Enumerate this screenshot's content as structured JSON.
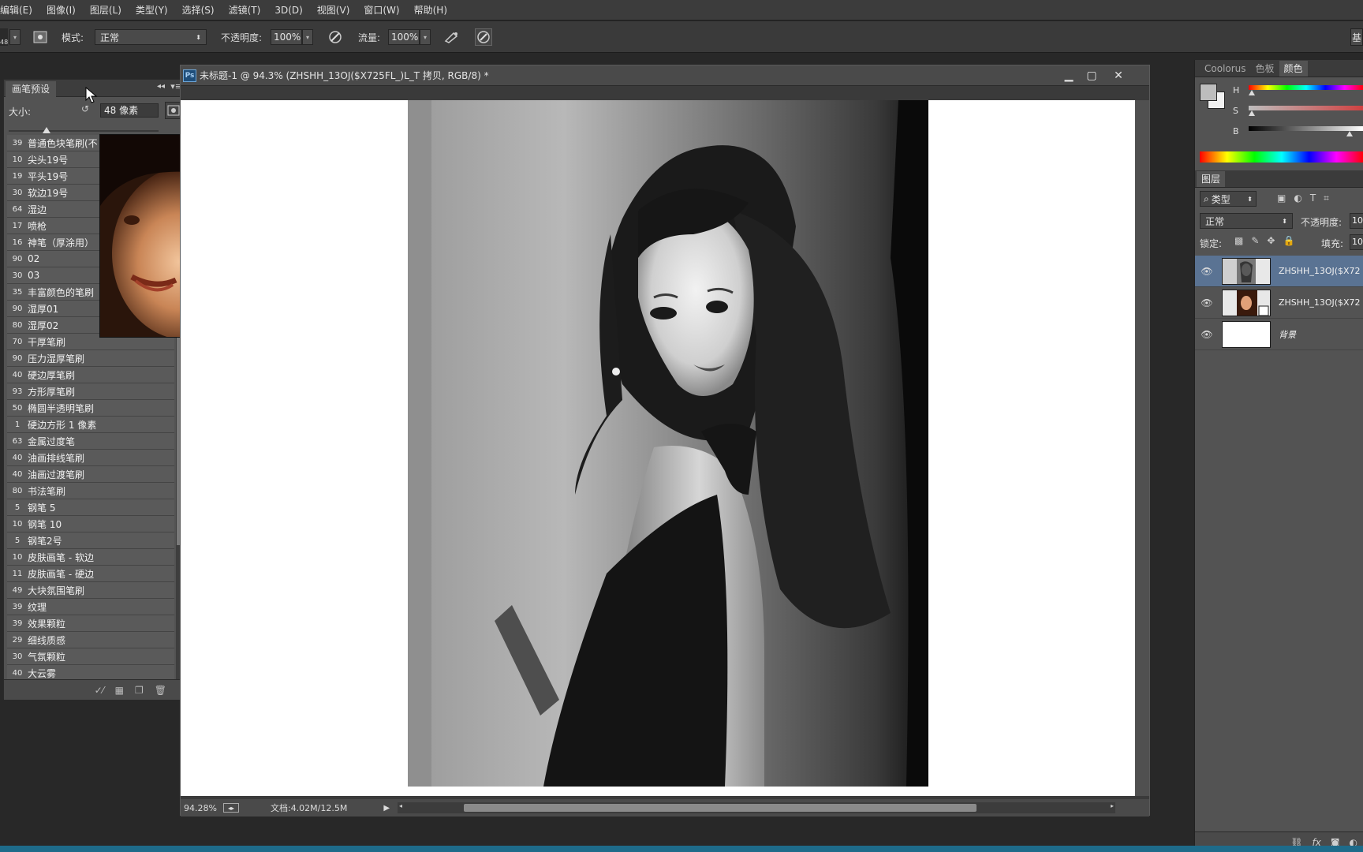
{
  "menubar": {
    "items": [
      "编辑(E)",
      "图像(I)",
      "图层(L)",
      "类型(Y)",
      "选择(S)",
      "滤镜(T)",
      "3D(D)",
      "视图(V)",
      "窗口(W)",
      "帮助(H)"
    ]
  },
  "optbar": {
    "brush_size_badge": "48",
    "mode_label": "模式:",
    "mode_value": "正常",
    "opacity_label": "不透明度:",
    "opacity_value": "100%",
    "flow_label": "流量:",
    "flow_value": "100%",
    "right_label": "基"
  },
  "document": {
    "title": "未标题-1 @ 94.3% (ZHSHH_13OJ($X725FL_)L_T 拷贝, RGB/8) *",
    "ps_badge": "Ps",
    "zoom": "94.28%",
    "doc_info": "文档:4.02M/12.5M"
  },
  "brush_panel": {
    "tab_label": "画笔预设",
    "size_label": "大小:",
    "size_value": "48 像素",
    "slider_fraction": 0.25,
    "brushes": [
      {
        "size": "39",
        "name": "普通色块笔刷(不"
      },
      {
        "size": "10",
        "name": "尖头19号"
      },
      {
        "size": "19",
        "name": "平头19号"
      },
      {
        "size": "30",
        "name": "软边19号"
      },
      {
        "size": "64",
        "name": "湿边"
      },
      {
        "size": "17",
        "name": "喷枪"
      },
      {
        "size": "16",
        "name": "神笔（厚涂用）"
      },
      {
        "size": "90",
        "name": "02"
      },
      {
        "size": "30",
        "name": "03"
      },
      {
        "size": "35",
        "name": "丰富颜色的笔刷"
      },
      {
        "size": "90",
        "name": "湿厚01"
      },
      {
        "size": "80",
        "name": "湿厚02"
      },
      {
        "size": "70",
        "name": "干厚笔刷"
      },
      {
        "size": "90",
        "name": "压力湿厚笔刷"
      },
      {
        "size": "40",
        "name": "硬边厚笔刷"
      },
      {
        "size": "93",
        "name": "方形厚笔刷"
      },
      {
        "size": "50",
        "name": "椭圆半透明笔刷"
      },
      {
        "size": "1",
        "name": "硬边方形 1 像素"
      },
      {
        "size": "63",
        "name": "金属过度笔"
      },
      {
        "size": "40",
        "name": "油画排线笔刷"
      },
      {
        "size": "40",
        "name": "油画过渡笔刷"
      },
      {
        "size": "80",
        "name": "书法笔刷"
      },
      {
        "size": "5",
        "name": "钢笔 5"
      },
      {
        "size": "10",
        "name": "钢笔 10"
      },
      {
        "size": "5",
        "name": "钢笔2号"
      },
      {
        "size": "10",
        "name": "皮肤画笔 - 软边"
      },
      {
        "size": "11",
        "name": "皮肤画笔 - 硬边"
      },
      {
        "size": "49",
        "name": "大块氛围笔刷"
      },
      {
        "size": "39",
        "name": "纹理"
      },
      {
        "size": "39",
        "name": "效果颗粒"
      },
      {
        "size": "29",
        "name": "细线质感"
      },
      {
        "size": "30",
        "name": "气氛颗粒"
      },
      {
        "size": "40",
        "name": "大云雾"
      }
    ]
  },
  "color_panel": {
    "tabs": [
      "Coolorus",
      "色板",
      "颜色"
    ],
    "active_tab": "颜色",
    "slider_labels": [
      "H",
      "S",
      "B"
    ]
  },
  "layers_panel": {
    "tab_label": "图层",
    "filter_label": "类型",
    "blend_mode": "正常",
    "opacity_label": "不透明度:",
    "opacity_value": "10",
    "lock_label": "锁定:",
    "fill_label": "填充:",
    "fill_value": "10",
    "layers": [
      {
        "name": "ZHSHH_13OJ($X72",
        "selected": true
      },
      {
        "name": "ZHSHH_13OJ($X72",
        "selected": false
      },
      {
        "name": "背景",
        "selected": false
      }
    ]
  },
  "colors": {
    "selection": "#5a7393",
    "accent_strip": "#1e6b8a"
  }
}
